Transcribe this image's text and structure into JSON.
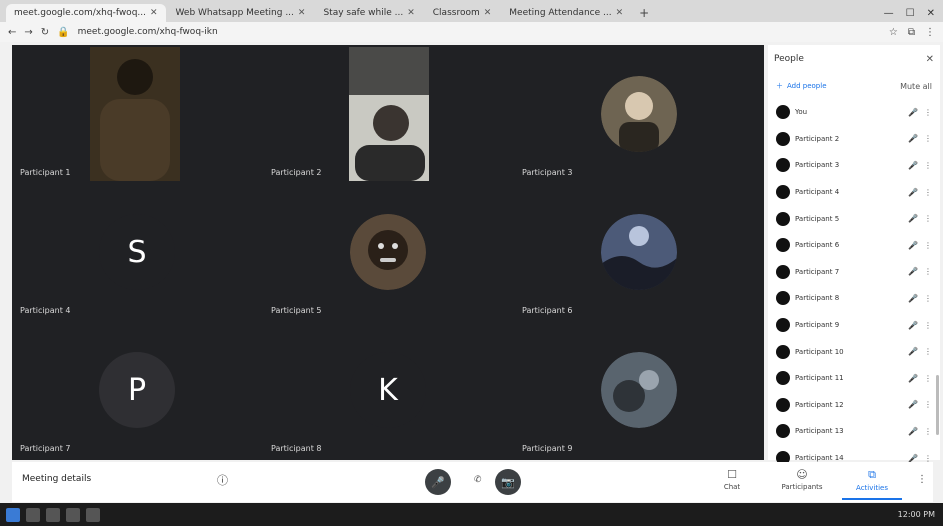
{
  "browser": {
    "tabs": [
      {
        "label": "meet.google.com/xhq-fwoq..."
      },
      {
        "label": "Web Whatsapp Meeting ..."
      },
      {
        "label": "Stay safe while ..."
      },
      {
        "label": "Classroom"
      },
      {
        "label": "Meeting Attendance ..."
      }
    ],
    "new_tab": "+",
    "address": "meet.google.com/xhq-fwoq-ikn",
    "window_controls": [
      "—",
      "☐",
      "✕"
    ]
  },
  "meeting": {
    "tiles": [
      {
        "type": "video",
        "name": "Participant 1",
        "bg": "#3b3020"
      },
      {
        "type": "video",
        "name": "Participant 2",
        "bg": "#c9c9c2"
      },
      {
        "type": "photo",
        "name": "Participant 3",
        "bg": "#6e6452"
      },
      {
        "type": "letter",
        "letter": "S",
        "name": "Participant 4",
        "bg": "#202124"
      },
      {
        "type": "photo",
        "name": "Participant 5",
        "bg": "#5a4a3a"
      },
      {
        "type": "photo",
        "name": "Participant 6",
        "bg": "#4c5a78"
      },
      {
        "type": "letter",
        "letter": "P",
        "name": "Participant 7",
        "bg": "#2f2f33"
      },
      {
        "type": "letter",
        "letter": "K",
        "name": "Participant 8",
        "bg": "#202124"
      },
      {
        "type": "photo",
        "name": "Participant 9",
        "bg": "#59646e"
      }
    ]
  },
  "controls": {
    "meeting_title": "Meeting details",
    "info_icon": "ⓘ",
    "mic_icon": "🎤",
    "cam_icon": "📷",
    "hangup_icon": "✆",
    "mid_dots": "•••",
    "items": [
      {
        "label": "Chat",
        "icon": "chat-icon"
      },
      {
        "label": "Participants",
        "icon": "people-icon"
      },
      {
        "label": "Activities",
        "icon": "activities-icon"
      }
    ],
    "more": "⋮"
  },
  "panel": {
    "title": "People",
    "close": "✕",
    "add_people": "Add people",
    "mute_all": "Mute all",
    "participants": [
      {
        "name": "You"
      },
      {
        "name": "Participant 2"
      },
      {
        "name": "Participant 3"
      },
      {
        "name": "Participant 4"
      },
      {
        "name": "Participant 5"
      },
      {
        "name": "Participant 6"
      },
      {
        "name": "Participant 7"
      },
      {
        "name": "Participant 8"
      },
      {
        "name": "Participant 9"
      },
      {
        "name": "Participant 10"
      },
      {
        "name": "Participant 11"
      },
      {
        "name": "Participant 12"
      },
      {
        "name": "Participant 13"
      },
      {
        "name": "Participant 14"
      }
    ]
  },
  "taskbar": {
    "clock": "12:00 PM"
  }
}
